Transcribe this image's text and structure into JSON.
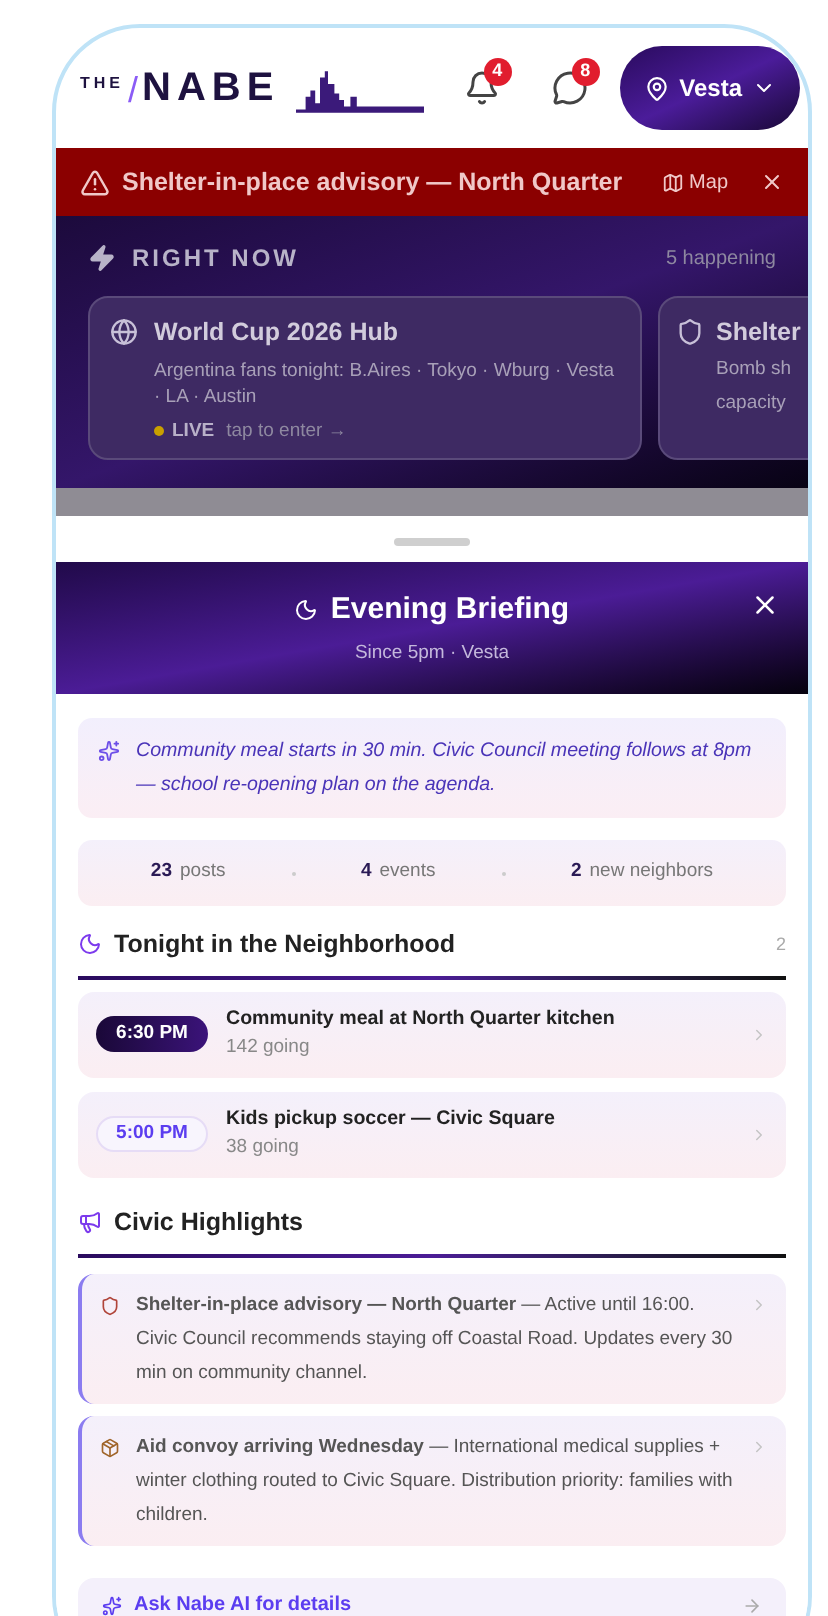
{
  "header": {
    "logo_small": "THE",
    "logo_slash": "/",
    "logo_main": "NABE",
    "notifications_badge": "4",
    "messages_badge": "8",
    "location": "Vesta"
  },
  "alert": {
    "text": "Shelter-in-place advisory — North Quarter",
    "map_label": "Map"
  },
  "right_now": {
    "title": "RIGHT NOW",
    "count": "5 happening",
    "cards": [
      {
        "kind": "globe",
        "title": "World Cup 2026 Hub",
        "body": "Argentina fans tonight: B.Aires · Tokyo · Wburg · Vesta · LA · Austin",
        "live": "LIVE",
        "action": "tap to enter →"
      },
      {
        "kind": "shield",
        "title": "Shelter",
        "body_lines": [
          "Bomb sh",
          "capacity"
        ]
      }
    ]
  },
  "sheet": {
    "title": "Evening Briefing",
    "subtitle": "Since 5pm · Vesta",
    "summary": "Community meal starts in 30 min. Civic Council meeting follows at 8pm — school re-opening plan on the agenda.",
    "stats": [
      {
        "value": "23",
        "label": "posts"
      },
      {
        "value": "4",
        "label": "events"
      },
      {
        "value": "2",
        "label": "new neighbors"
      }
    ],
    "tonight": {
      "title": "Tonight in the Neighborhood",
      "count": "2",
      "events": [
        {
          "time": "6:30 PM",
          "title": "Community meal at North Quarter kitchen",
          "going": "142 going",
          "highlighted": true
        },
        {
          "time": "5:00 PM",
          "title": "Kids pickup soccer — Civic Square",
          "going": "38 going",
          "highlighted": false
        }
      ]
    },
    "civic": {
      "title": "Civic Highlights",
      "items": [
        {
          "kind": "shield",
          "text": "**Shelter-in-place advisory — North Quarter** — Active until 16:00. Civic Council recommends staying off Coastal Road. Updates every 30 min on community channel."
        },
        {
          "kind": "package",
          "text": "**Aid convoy arriving Wednesday** — International medical supplies + winter clothing routed to Civic Square. Distribution priority: families with children."
        }
      ]
    },
    "ask": "Ask Nabe AI for details"
  }
}
